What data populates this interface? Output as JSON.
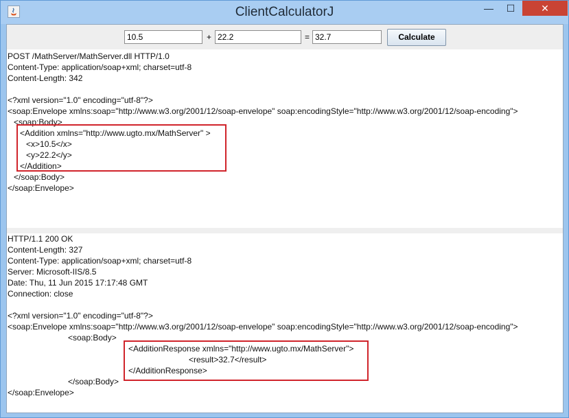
{
  "window": {
    "title": "ClientCalculatorJ",
    "minimize_glyph": "—",
    "maximize_glyph": "☐",
    "close_glyph": "✕"
  },
  "toolbar": {
    "operand_a": "10.5",
    "operator": "+",
    "operand_b": "22.2",
    "equals": "=",
    "result": "32.7",
    "calculate_label": "Calculate"
  },
  "request": {
    "lines": [
      "POST /MathServer/MathServer.dll HTTP/1.0",
      "Content-Type: application/soap+xml; charset=utf-8",
      "Content-Length: 342",
      "",
      "<?xml version=\"1.0\" encoding=\"utf-8\"?>",
      "<soap:Envelope xmlns:soap=\"http://www.w3.org/2001/12/soap-envelope\" soap:encodingStyle=\"http://www.w3.org/2001/12/soap-encoding\">",
      "<soap:Body>",
      "<Addition xmlns=\"http://www.ugto.mx/MathServer\" >",
      "<x>10.5</x>",
      "<y>22.2</y>",
      "</Addition>",
      "</soap:Body>",
      "</soap:Envelope>"
    ]
  },
  "response": {
    "lines": [
      "HTTP/1.1 200 OK",
      "Content-Length: 327",
      "Content-Type: application/soap+xml; charset=utf-8",
      "Server: Microsoft-IIS/8.5",
      "Date: Thu, 11 Jun 2015 17:17:48 GMT",
      "Connection: close",
      "",
      "<?xml version=\"1.0\" encoding=\"utf-8\"?>",
      "<soap:Envelope xmlns:soap=\"http://www.w3.org/2001/12/soap-envelope\" soap:encodingStyle=\"http://www.w3.org/2001/12/soap-encoding\">",
      "<soap:Body>",
      "<AdditionResponse xmlns=\"http://www.ugto.mx/MathServer\">",
      "<result>32.7</result>",
      "</AdditionResponse>",
      "</soap:Body>",
      "</soap:Envelope>"
    ]
  },
  "colors": {
    "highlight": "#d0232a",
    "close_button": "#c94334",
    "title_bar": "#a9cdf2"
  }
}
